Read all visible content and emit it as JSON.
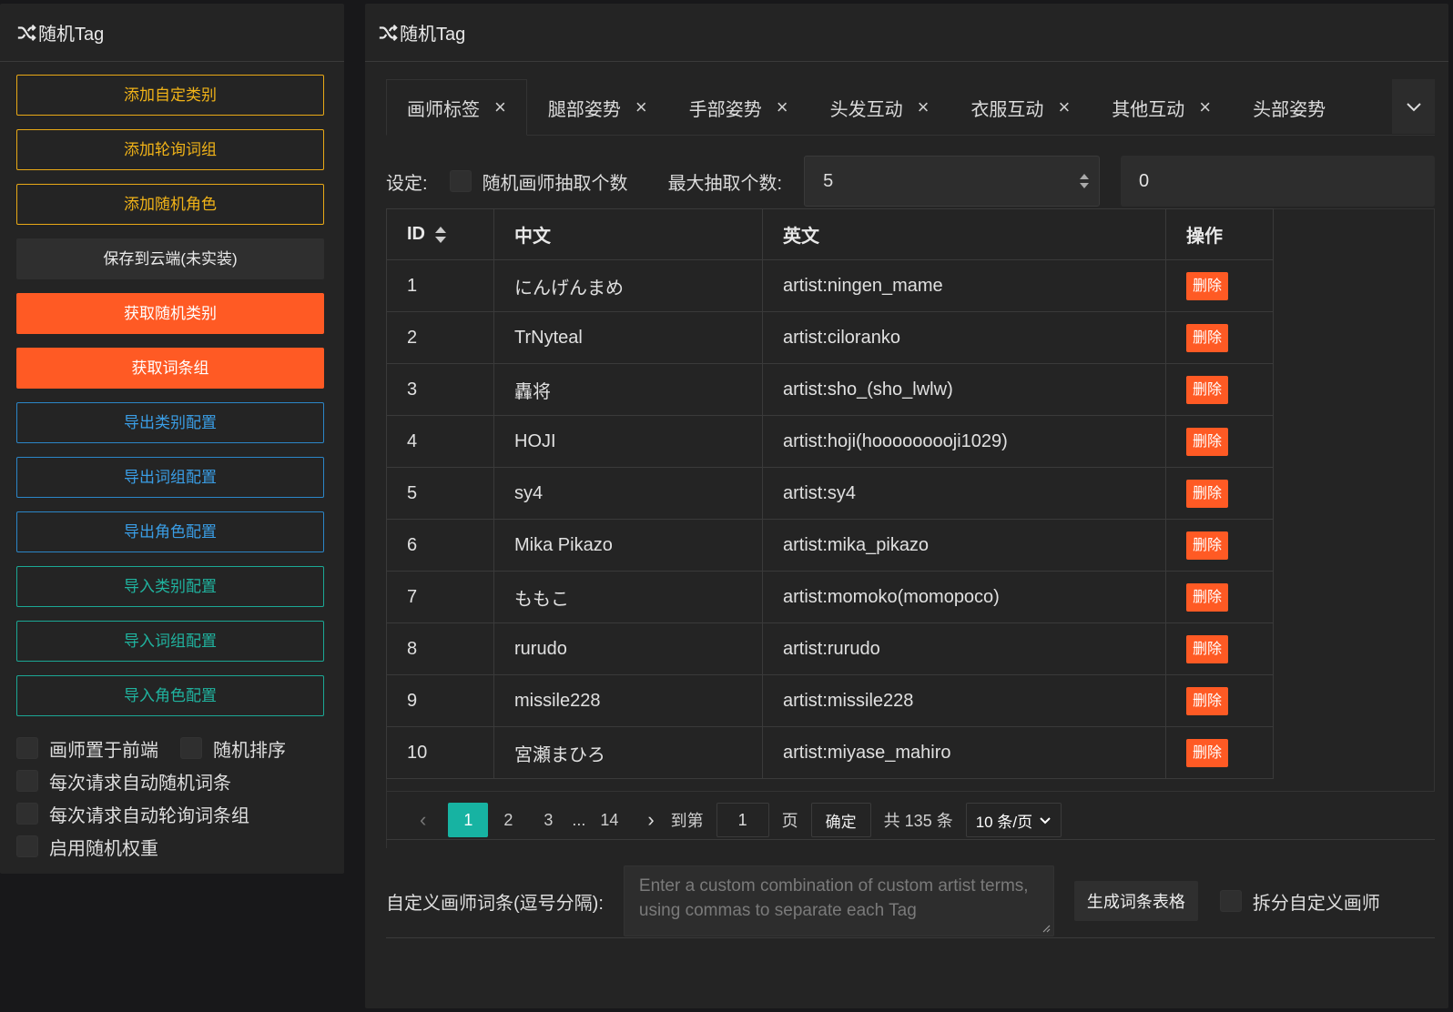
{
  "title": "随机Tag",
  "left": {
    "buttons": {
      "add_category": "添加自定类别",
      "add_rotation": "添加轮询词组",
      "add_character": "添加随机角色",
      "save_cloud": "保存到云端(未实装)",
      "get_category": "获取随机类别",
      "get_group": "获取词条组",
      "export_category": "导出类别配置",
      "export_group": "导出词组配置",
      "export_character": "导出角色配置",
      "import_category": "导入类别配置",
      "import_group": "导入词组配置",
      "import_character": "导入角色配置"
    },
    "checks": {
      "artist_front": "画师置于前端",
      "random_sort": "随机排序",
      "auto_random": "每次请求自动随机词条",
      "auto_rotate": "每次请求自动轮询词条组",
      "enable_weight": "启用随机权重"
    }
  },
  "tabs": [
    "画师标签",
    "腿部姿势",
    "手部姿势",
    "头发互动",
    "衣服互动",
    "其他互动",
    "头部姿势"
  ],
  "settings": {
    "label": "设定:",
    "random_count": "随机画师抽取个数",
    "max_label": "最大抽取个数:",
    "max_value": "5",
    "second_value": "0"
  },
  "table": {
    "headers": {
      "id": "ID",
      "cn": "中文",
      "en": "英文",
      "op": "操作"
    },
    "delete_label": "删除",
    "rows": [
      {
        "id": "1",
        "cn": "にんげんまめ",
        "en": "artist:ningen_mame"
      },
      {
        "id": "2",
        "cn": "TrNyteal",
        "en": "artist:ciloranko"
      },
      {
        "id": "3",
        "cn": "轟将",
        "en": "artist:sho_(sho_lwlw)"
      },
      {
        "id": "4",
        "cn": "HOJI",
        "en": "artist:hoji(hooooooooji1029)"
      },
      {
        "id": "5",
        "cn": "sy4",
        "en": "artist:sy4"
      },
      {
        "id": "6",
        "cn": "Mika Pikazo",
        "en": "artist:mika_pikazo"
      },
      {
        "id": "7",
        "cn": "ももこ",
        "en": "artist:momoko(momopoco)"
      },
      {
        "id": "8",
        "cn": "rurudo",
        "en": "artist:rurudo"
      },
      {
        "id": "9",
        "cn": "missile228",
        "en": "artist:missile228"
      },
      {
        "id": "10",
        "cn": "宮瀬まひろ",
        "en": "artist:miyase_mahiro"
      }
    ]
  },
  "pager": {
    "pages": [
      "1",
      "2",
      "3"
    ],
    "ellipsis": "...",
    "last": "14",
    "goto": "到第",
    "goto_value": "1",
    "page_unit": "页",
    "confirm": "确定",
    "total": "共 135 条",
    "size": "10 条/页"
  },
  "custom": {
    "label": "自定义画师词条(逗号分隔):",
    "placeholder": "Enter a custom combination of custom artist terms, using commas to separate each Tag",
    "generate": "生成词条表格",
    "split": "拆分自定义画师"
  },
  "colors": {
    "accent_orange": "#ff5a24",
    "accent_teal": "#17b3a2",
    "warning_yellow": "#f1b318",
    "info_blue": "#3a9ee6"
  }
}
